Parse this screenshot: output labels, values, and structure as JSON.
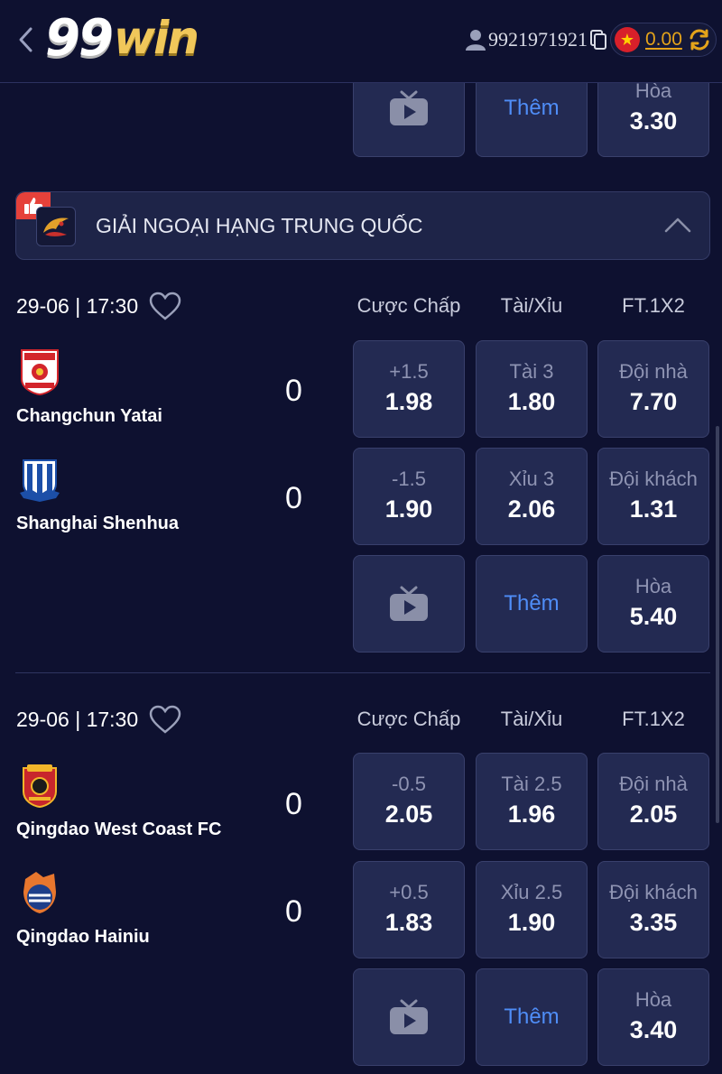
{
  "header": {
    "logo_num": "99",
    "logo_win": "win",
    "user_id": "9921971921",
    "balance": "0.00",
    "colors": {
      "accent_gold": "#e4a31a",
      "background": "#0e1130",
      "link_blue": "#4f8df7"
    }
  },
  "prev_match": {
    "more_label": "Thêm",
    "draw_label": "Hòa",
    "draw_value": "3.30"
  },
  "league": {
    "name": "GIẢI NGOẠI HẠNG TRUNG QUỐC"
  },
  "columns": {
    "handicap": "Cược Chấp",
    "over_under": "Tài/Xỉu",
    "ft1x2": "FT.1X2"
  },
  "matches": [
    {
      "datetime": "29-06 | 17:30",
      "home": {
        "name": "Changchun Yatai",
        "score": "0",
        "handicap_line": "+1.5",
        "handicap_odds": "1.98",
        "ou_line": "Tài 3",
        "ou_odds": "1.80",
        "x2_label": "Đội nhà",
        "x2_odds": "7.70"
      },
      "away": {
        "name": "Shanghai Shenhua",
        "score": "0",
        "handicap_line": "-1.5",
        "handicap_odds": "1.90",
        "ou_line": "Xỉu 3",
        "ou_odds": "2.06",
        "x2_label": "Đội khách",
        "x2_odds": "1.31"
      },
      "more_label": "Thêm",
      "draw_label": "Hòa",
      "draw_odds": "5.40"
    },
    {
      "datetime": "29-06 | 17:30",
      "home": {
        "name": "Qingdao West Coast FC",
        "score": "0",
        "handicap_line": "-0.5",
        "handicap_odds": "2.05",
        "ou_line": "Tài 2.5",
        "ou_odds": "1.96",
        "x2_label": "Đội nhà",
        "x2_odds": "2.05"
      },
      "away": {
        "name": "Qingdao Hainiu",
        "score": "0",
        "handicap_line": "+0.5",
        "handicap_odds": "1.83",
        "ou_line": "Xỉu 2.5",
        "ou_odds": "1.90",
        "x2_label": "Đội khách",
        "x2_odds": "3.35"
      },
      "more_label": "Thêm",
      "draw_label": "Hòa",
      "draw_odds": "3.40"
    }
  ]
}
